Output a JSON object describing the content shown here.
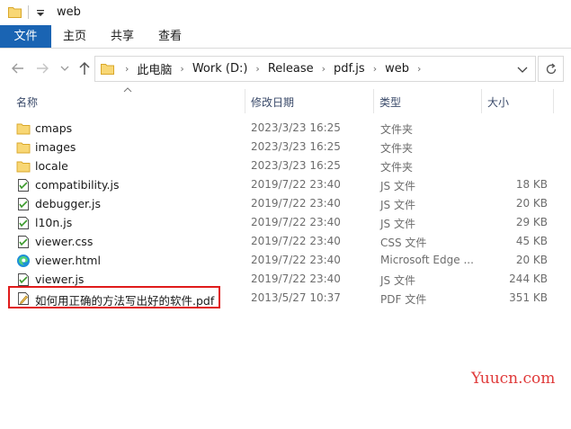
{
  "window": {
    "title": "web"
  },
  "ribbon": {
    "tabs": [
      {
        "label": "文件",
        "active": true
      },
      {
        "label": "主页"
      },
      {
        "label": "共享"
      },
      {
        "label": "查看"
      }
    ],
    "accent": "#1a64b3"
  },
  "address": {
    "breadcrumbs": [
      "此电脑",
      "Work (D:)",
      "Release",
      "pdf.js",
      "web"
    ],
    "separator": "›"
  },
  "columns": {
    "name": "名称",
    "date": "修改日期",
    "type": "类型",
    "size": "大小"
  },
  "files": [
    {
      "icon": "folder-icon",
      "name": "cmaps",
      "date": "2023/3/23 16:25",
      "type": "文件夹",
      "size": ""
    },
    {
      "icon": "folder-icon",
      "name": "images",
      "date": "2023/3/23 16:25",
      "type": "文件夹",
      "size": ""
    },
    {
      "icon": "folder-icon",
      "name": "locale",
      "date": "2023/3/23 16:25",
      "type": "文件夹",
      "size": ""
    },
    {
      "icon": "script-file-icon",
      "name": "compatibility.js",
      "date": "2019/7/22 23:40",
      "type": "JS 文件",
      "size": "18 KB"
    },
    {
      "icon": "script-file-icon",
      "name": "debugger.js",
      "date": "2019/7/22 23:40",
      "type": "JS 文件",
      "size": "20 KB"
    },
    {
      "icon": "script-file-icon",
      "name": "l10n.js",
      "date": "2019/7/22 23:40",
      "type": "JS 文件",
      "size": "29 KB"
    },
    {
      "icon": "script-file-icon",
      "name": "viewer.css",
      "date": "2019/7/22 23:40",
      "type": "CSS 文件",
      "size": "45 KB"
    },
    {
      "icon": "edge-icon",
      "name": "viewer.html",
      "date": "2019/7/22 23:40",
      "type": "Microsoft Edge ...",
      "size": "20 KB"
    },
    {
      "icon": "script-file-icon",
      "name": "viewer.js",
      "date": "2019/7/22 23:40",
      "type": "JS 文件",
      "size": "244 KB"
    },
    {
      "icon": "pdf-file-icon",
      "name": "如何用正确的方法写出好的软件.pdf",
      "date": "2013/5/27 10:37",
      "type": "PDF 文件",
      "size": "351 KB"
    }
  ],
  "highlight_color": "#e01b1b",
  "watermark": "Yuucn.com"
}
